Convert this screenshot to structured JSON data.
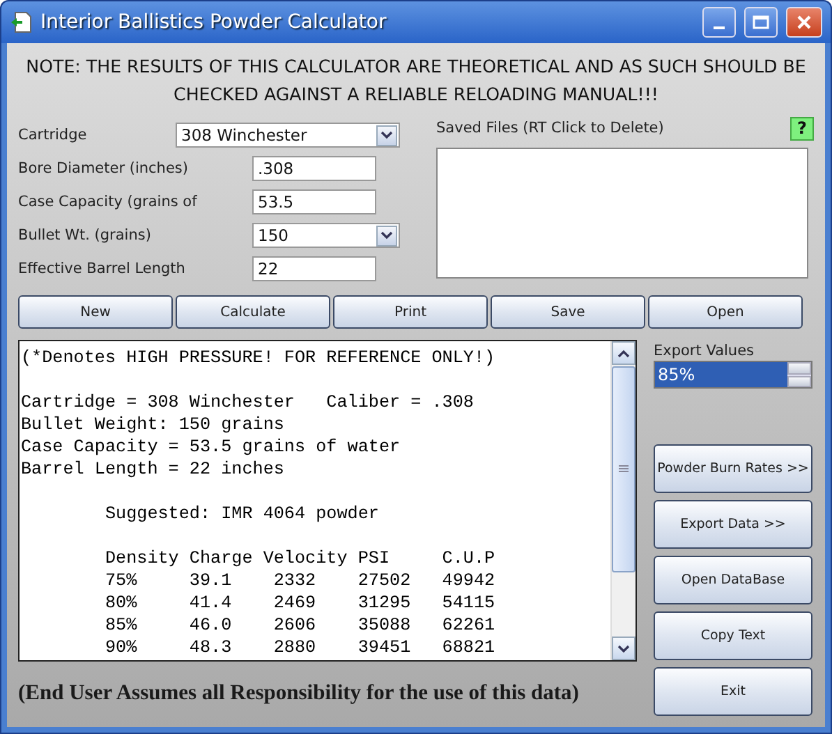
{
  "window": {
    "title": "Interior Ballistics Powder Calculator"
  },
  "note": [
    "NOTE: THE RESULTS OF THIS CALCULATOR ARE THEORETICAL AND AS SUCH SHOULD BE",
    "CHECKED AGAINST A RELIABLE RELOADING MANUAL!!!"
  ],
  "form": [
    {
      "label": "Cartridge",
      "kind": "dropdown",
      "value": "308 Winchester"
    },
    {
      "label": "Bore Diameter (inches)",
      "kind": "input",
      "value": ".308"
    },
    {
      "label": "Case Capacity (grains of",
      "kind": "input",
      "value": "53.5"
    },
    {
      "label": "Bullet Wt. (grains)",
      "kind": "dropdown",
      "value": "150"
    },
    {
      "label": "Effective Barrel Length",
      "kind": "input",
      "value": "22"
    }
  ],
  "saved_files": {
    "label": "Saved Files (RT Click to Delete)",
    "help": "?"
  },
  "toolbar": [
    "New",
    "Calculate",
    "Print",
    "Save",
    "Open"
  ],
  "report": [
    [
      "(*Denotes HIGH PRESSURE! FOR REFERENCE ONLY!)"
    ],
    [
      "Cartridge = 308 Winchester   Caliber = .308",
      "Bullet Weight: 150 grains",
      "Case Capacity = 53.5 grains of water",
      "Barrel Length = 22 inches"
    ],
    [
      "        Suggested: IMR 4064 powder"
    ],
    [
      "        Density Charge Velocity PSI     C.U.P",
      "        75%     39.1    2332    27502   49942",
      "        80%     41.4    2469    31295   54115",
      "        85%     46.0    2606    35088   62261",
      "        90%     48.3    2880    39451   68821"
    ]
  ],
  "export": {
    "label": "Export Values",
    "value": "85%"
  },
  "side_buttons": [
    "Powder Burn Rates >>",
    "Export Data >>",
    "Open DataBase",
    "Copy Text",
    "Exit"
  ],
  "footer": "(End User Assumes all Responsibility for the use of this data)"
}
